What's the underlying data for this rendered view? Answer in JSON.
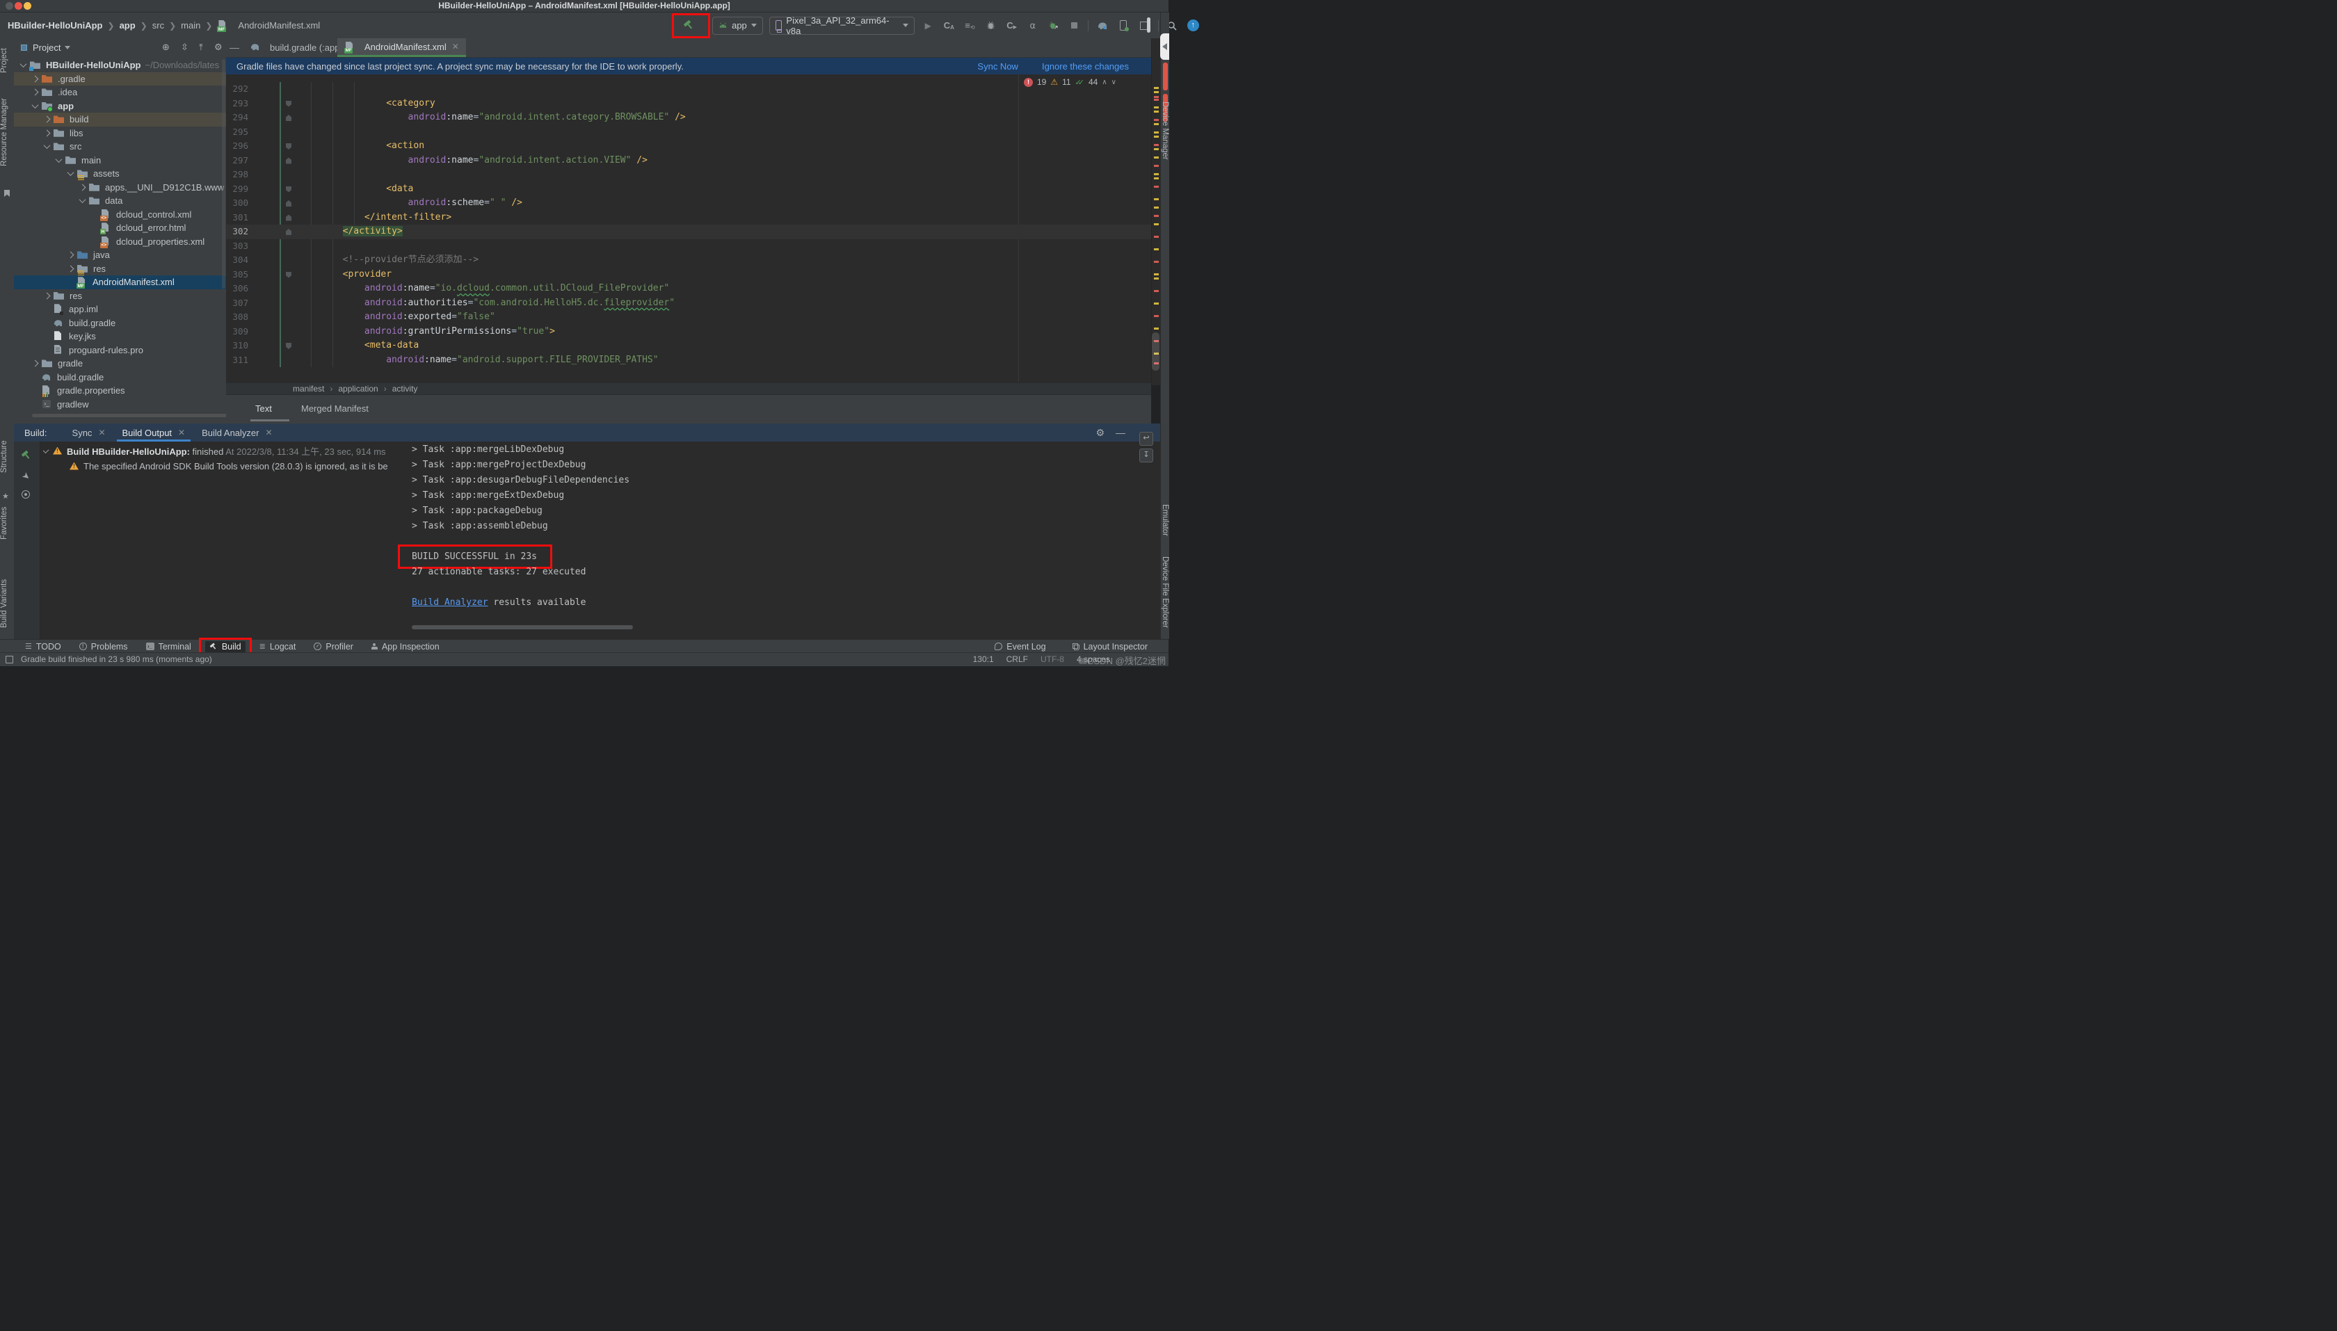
{
  "window": {
    "title": "HBuilder-HelloUniApp – AndroidManifest.xml [HBuilder-HelloUniApp.app]"
  },
  "navbar": {
    "path": [
      "HBuilder-HelloUniApp",
      "app",
      "src",
      "main",
      "AndroidManifest.xml"
    ],
    "run_config": "app",
    "device": "Pixel_3a_API_32_arm64-v8a"
  },
  "left_strip": {
    "top": [
      "Project",
      "Resource Manager"
    ],
    "bottom": [
      "Structure",
      "Favorites",
      "Build Variants"
    ]
  },
  "right_strip": [
    "Device Manager",
    "Emulator",
    "Device File Explorer"
  ],
  "project_panel": {
    "title": "Project",
    "tree": [
      {
        "label": "HBuilder-HelloUniApp",
        "suffix": " ~/Downloads/lates",
        "level": 0,
        "icon": "folder-project",
        "arrow": "open",
        "bold": true
      },
      {
        "label": ".gradle",
        "level": 1,
        "icon": "folder-orange",
        "arrow": "closed",
        "row": "hl"
      },
      {
        "label": ".idea",
        "level": 1,
        "icon": "folder",
        "arrow": "closed"
      },
      {
        "label": "app",
        "level": 1,
        "icon": "folder-app",
        "arrow": "open",
        "bold": true
      },
      {
        "label": "build",
        "level": 2,
        "icon": "folder-orange",
        "arrow": "closed",
        "row": "hl"
      },
      {
        "label": "libs",
        "level": 2,
        "icon": "folder",
        "arrow": "closed"
      },
      {
        "label": "src",
        "level": 2,
        "icon": "folder",
        "arrow": "open"
      },
      {
        "label": "main",
        "level": 3,
        "icon": "folder",
        "arrow": "open"
      },
      {
        "label": "assets",
        "level": 4,
        "icon": "folder-lines",
        "arrow": "open"
      },
      {
        "label": "apps.__UNI__D912C1B.www",
        "level": 5,
        "icon": "folder",
        "arrow": "closed"
      },
      {
        "label": "data",
        "level": 5,
        "icon": "folder",
        "arrow": "open"
      },
      {
        "label": "dcloud_control.xml",
        "level": 6,
        "icon": "xml"
      },
      {
        "label": "dcloud_error.html",
        "level": 6,
        "icon": "html"
      },
      {
        "label": "dcloud_properties.xml",
        "level": 6,
        "icon": "xml"
      },
      {
        "label": "java",
        "level": 4,
        "icon": "folder-blue",
        "arrow": "closed"
      },
      {
        "label": "res",
        "level": 4,
        "icon": "folder-lines",
        "arrow": "closed"
      },
      {
        "label": "AndroidManifest.xml",
        "level": 4,
        "icon": "mf",
        "row": "sel"
      },
      {
        "label": "res",
        "level": 2,
        "icon": "folder",
        "arrow": "closed"
      },
      {
        "label": "app.iml",
        "level": 2,
        "icon": "iml"
      },
      {
        "label": "build.gradle",
        "level": 2,
        "icon": "gradle"
      },
      {
        "label": "key.jks",
        "level": 2,
        "icon": "file"
      },
      {
        "label": "proguard-rules.pro",
        "level": 2,
        "icon": "file-lines"
      },
      {
        "label": "gradle",
        "level": 1,
        "icon": "folder",
        "arrow": "closed"
      },
      {
        "label": "build.gradle",
        "level": 1,
        "icon": "gradle"
      },
      {
        "label": "gradle.properties",
        "level": 1,
        "icon": "properties"
      },
      {
        "label": "gradlew",
        "level": 1,
        "icon": "gradlew"
      }
    ]
  },
  "editor": {
    "tabs": [
      {
        "label": "build.gradle (:app)",
        "icon": "gradle"
      },
      {
        "label": "AndroidManifest.xml",
        "icon": "mf",
        "active": true
      }
    ],
    "banner": {
      "text": "Gradle files have changed since last project sync. A project sync may be necessary for the IDE to work properly.",
      "sync": "Sync Now",
      "ignore": "Ignore these changes"
    },
    "inspections": {
      "errors": "19",
      "warnings": "11",
      "passed": "44"
    },
    "code_lines": [
      {
        "n": "292",
        "parts": []
      },
      {
        "n": "293",
        "fold": "start",
        "parts": [
          [
            "                ",
            "p"
          ],
          [
            "<category",
            "t"
          ]
        ]
      },
      {
        "n": "294",
        "fold": "end",
        "parts": [
          [
            "                    ",
            "p"
          ],
          [
            "android",
            "a"
          ],
          [
            ":name",
            "n"
          ],
          [
            "=",
            "p"
          ],
          [
            "\"android.intent.category.BROWSABLE\"",
            "s"
          ],
          [
            " ",
            "p"
          ],
          [
            "/>",
            "t"
          ]
        ]
      },
      {
        "n": "295",
        "parts": []
      },
      {
        "n": "296",
        "fold": "start",
        "parts": [
          [
            "                ",
            "p"
          ],
          [
            "<action",
            "t"
          ]
        ]
      },
      {
        "n": "297",
        "fold": "end",
        "parts": [
          [
            "                    ",
            "p"
          ],
          [
            "android",
            "a"
          ],
          [
            ":name",
            "n"
          ],
          [
            "=",
            "p"
          ],
          [
            "\"android.intent.action.VIEW\"",
            "s"
          ],
          [
            " ",
            "p"
          ],
          [
            "/>",
            "t"
          ]
        ]
      },
      {
        "n": "298",
        "parts": []
      },
      {
        "n": "299",
        "fold": "start",
        "parts": [
          [
            "                ",
            "p"
          ],
          [
            "<data",
            "t"
          ]
        ]
      },
      {
        "n": "300",
        "fold": "end",
        "parts": [
          [
            "                    ",
            "p"
          ],
          [
            "android",
            "a"
          ],
          [
            ":scheme",
            "n"
          ],
          [
            "=",
            "p"
          ],
          [
            "\" \"",
            "s"
          ],
          [
            " ",
            "p"
          ],
          [
            "/>",
            "t"
          ]
        ]
      },
      {
        "n": "301",
        "fold": "end",
        "parts": [
          [
            "            ",
            "p"
          ],
          [
            "</intent-filter>",
            "t"
          ]
        ]
      },
      {
        "n": "302",
        "fold": "end",
        "current": true,
        "parts": [
          [
            "        ",
            "p"
          ],
          [
            "</activity>",
            "tm"
          ]
        ]
      },
      {
        "n": "303",
        "parts": []
      },
      {
        "n": "304",
        "parts": [
          [
            "        ",
            "p"
          ],
          [
            "<!--provider节点必须添加-->",
            "c"
          ]
        ]
      },
      {
        "n": "305",
        "fold": "start",
        "parts": [
          [
            "        ",
            "p"
          ],
          [
            "<provider",
            "t"
          ]
        ]
      },
      {
        "n": "306",
        "parts": [
          [
            "            ",
            "p"
          ],
          [
            "android",
            "a"
          ],
          [
            ":name",
            "n"
          ],
          [
            "=",
            "p"
          ],
          [
            "\"io.",
            "s"
          ],
          [
            "dcloud",
            "su"
          ],
          [
            ".common.util.DCloud_FileProvider\"",
            "s"
          ]
        ]
      },
      {
        "n": "307",
        "parts": [
          [
            "            ",
            "p"
          ],
          [
            "android",
            "a"
          ],
          [
            ":authorities",
            "n"
          ],
          [
            "=",
            "p"
          ],
          [
            "\"com.android.HelloH5.dc.",
            "s"
          ],
          [
            "fileprovider",
            "su"
          ],
          [
            "\"",
            "s"
          ]
        ]
      },
      {
        "n": "308",
        "parts": [
          [
            "            ",
            "p"
          ],
          [
            "android",
            "a"
          ],
          [
            ":exported",
            "n"
          ],
          [
            "=",
            "p"
          ],
          [
            "\"false\"",
            "s"
          ]
        ]
      },
      {
        "n": "309",
        "parts": [
          [
            "            ",
            "p"
          ],
          [
            "android",
            "a"
          ],
          [
            ":grantUriPermissions",
            "n"
          ],
          [
            "=",
            "p"
          ],
          [
            "\"true\"",
            "s"
          ],
          [
            ">",
            "t"
          ]
        ]
      },
      {
        "n": "310",
        "fold": "start",
        "parts": [
          [
            "            ",
            "p"
          ],
          [
            "<meta-data",
            "t"
          ]
        ]
      },
      {
        "n": "311",
        "parts": [
          [
            "                ",
            "p"
          ],
          [
            "android",
            "a"
          ],
          [
            ":name",
            "n"
          ],
          [
            "=",
            "p"
          ],
          [
            "\"android.support.FILE_PROVIDER_PATHS\"",
            "s"
          ]
        ]
      }
    ],
    "breadcrumbs": [
      "manifest",
      "application",
      "activity"
    ],
    "view_tabs": [
      {
        "label": "Text",
        "active": true
      },
      {
        "label": "Merged Manifest"
      }
    ]
  },
  "build_panel": {
    "label": "Build:",
    "tabs": [
      {
        "label": "Sync"
      },
      {
        "label": "Build Output",
        "active": true
      },
      {
        "label": "Build Analyzer"
      }
    ],
    "tree": [
      {
        "bold": "Build HBuilder-HelloUniApp:",
        "rest": " finished",
        "meta": " At 2022/3/8, 11:34 上午, 23 sec, 914 ms"
      },
      {
        "rest": "The specified Android SDK Build Tools version (28.0.3) is ignored, as it is be"
      }
    ],
    "console": [
      {
        "text": "> Task :app:mergeLibDexDebug"
      },
      {
        "text": "> Task :app:mergeProjectDexDebug"
      },
      {
        "text": "> Task :app:desugarDebugFileDependencies"
      },
      {
        "text": "> Task :app:mergeExtDexDebug"
      },
      {
        "text": "> Task :app:packageDebug"
      },
      {
        "text": "> Task :app:assembleDebug"
      },
      {
        "text": ""
      },
      {
        "text": "BUILD SUCCESSFUL in 23s",
        "boxed": true
      },
      {
        "text": "27 actionable tasks: 27 executed"
      },
      {
        "text": ""
      },
      {
        "link": "Build Analyzer",
        "text": " results available"
      }
    ]
  },
  "bottom_bar": {
    "left": [
      {
        "label": "TODO"
      },
      {
        "label": "Problems"
      },
      {
        "label": "Terminal"
      },
      {
        "label": "Build",
        "active": true,
        "boxed": true
      },
      {
        "label": "Logcat"
      },
      {
        "label": "Profiler"
      },
      {
        "label": "App Inspection"
      }
    ],
    "right": [
      {
        "label": "Event Log"
      },
      {
        "label": "Layout Inspector"
      }
    ]
  },
  "status_bar": {
    "message": "Gradle build finished in 23 s 980 ms (moments ago)",
    "position": "130:1",
    "line_sep": "CRLF",
    "encoding": "UTF-8",
    "indent": "4 spaces",
    "watermark": "CSDN @残忆2迷惘"
  }
}
